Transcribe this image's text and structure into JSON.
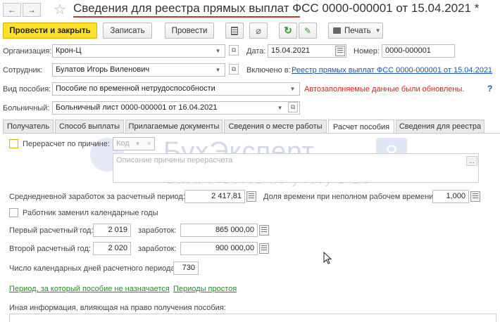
{
  "window": {
    "title": "Сведения для реестра прямых выплат ФСС 0000-000001 от 15.04.2021 *"
  },
  "nav": {
    "back_glyph": "←",
    "forward_glyph": "→",
    "star_glyph": "☆"
  },
  "toolbar": {
    "post_close": "Провести и закрыть",
    "save": "Записать",
    "post": "Провести",
    "print": "Печать"
  },
  "form": {
    "org_label": "Организация:",
    "org_value": "Крон-Ц",
    "date_label": "Дата:",
    "date_value": "15.04.2021",
    "number_label": "Номер:",
    "number_value": "0000-000001",
    "employee_label": "Сотрудник:",
    "employee_value": "Булатов Игорь Виленович",
    "included_label": "Включено в:",
    "included_link": "Реестр прямых выплат ФСС 0000-000001 от 15.04.2021",
    "benefit_type_label": "Вид пособия:",
    "benefit_type_value": "Пособие по временной нетрудоспособности",
    "autofill_notice": "Автозаполняемые данные были обновлены.",
    "help": "?",
    "sick_leave_label": "Больничный:",
    "sick_leave_value": "Больничный лист 0000-000001 от 16.04.2021"
  },
  "tabs": [
    {
      "label": "Получатель"
    },
    {
      "label": "Способ выплаты"
    },
    {
      "label": "Прилагаемые документы"
    },
    {
      "label": "Сведения о месте работы"
    },
    {
      "label": "Расчет пособия"
    },
    {
      "label": "Сведения для реестра"
    }
  ],
  "calc": {
    "recalc_label": "Перерасчет по причине:",
    "code_placeholder": "Код",
    "reason_placeholder": "Описание причины перерасчета",
    "avg_earnings_label": "Среднедневной заработок за расчетный период:",
    "avg_earnings_value": "2 417,81",
    "time_share_label": "Доля времени при неполном рабочем времени:",
    "time_share_value": "1,000",
    "replaced_years_label": "Работник заменил календарные годы",
    "first_year_label": "Первый расчетный год:",
    "first_year_value": "2 019",
    "earnings_label": "заработок:",
    "first_earnings_value": "865 000,00",
    "second_year_label": "Второй расчетный год:",
    "second_year_value": "2 020",
    "second_earnings_value": "900 000,00",
    "days_label": "Число календарных дней расчетного периода:",
    "days_value": "730",
    "link_not_assigned": "Период, за который пособие не назначается",
    "link_idle": "Периоды простоя",
    "other_info_label": "Иная информация, влияющая на право получения пособия:"
  },
  "watermark": {
    "brand": "БухЭксперт",
    "digit": "8",
    "tagline": "База ответов по учёту в 1С"
  }
}
